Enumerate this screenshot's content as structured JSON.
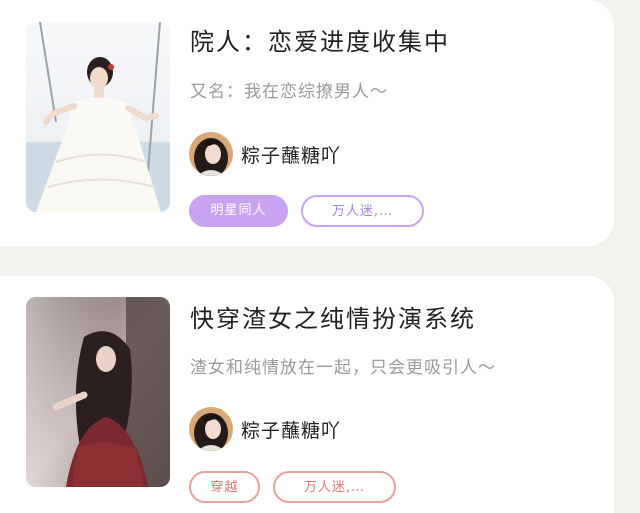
{
  "books": [
    {
      "title": "院人：恋爱进度收集中",
      "subtitle": "又名：我在恋综撩男人～",
      "author": "粽子蘸糖吖",
      "tags": [
        "明星同人",
        "万人迷,…"
      ],
      "cover_icon": "woman-white-dress-swing-image",
      "avatar_icon": "author-avatar-image"
    },
    {
      "title": "快穿渣女之纯情扮演系统",
      "subtitle": "渣女和纯情放在一起，只会更吸引人～",
      "author": "粽子蘸糖吖",
      "tags": [
        "穿越",
        "万人迷,…"
      ],
      "cover_icon": "woman-red-dress-image",
      "avatar_icon": "author-avatar-image"
    }
  ],
  "colors": {
    "background": "#f3f1ed",
    "card": "#ffffff",
    "tag_purple": "#c8a3ef",
    "tag_red": "#e5a3a0",
    "title_text": "#222222",
    "subtitle_text": "#9a9a9a"
  }
}
